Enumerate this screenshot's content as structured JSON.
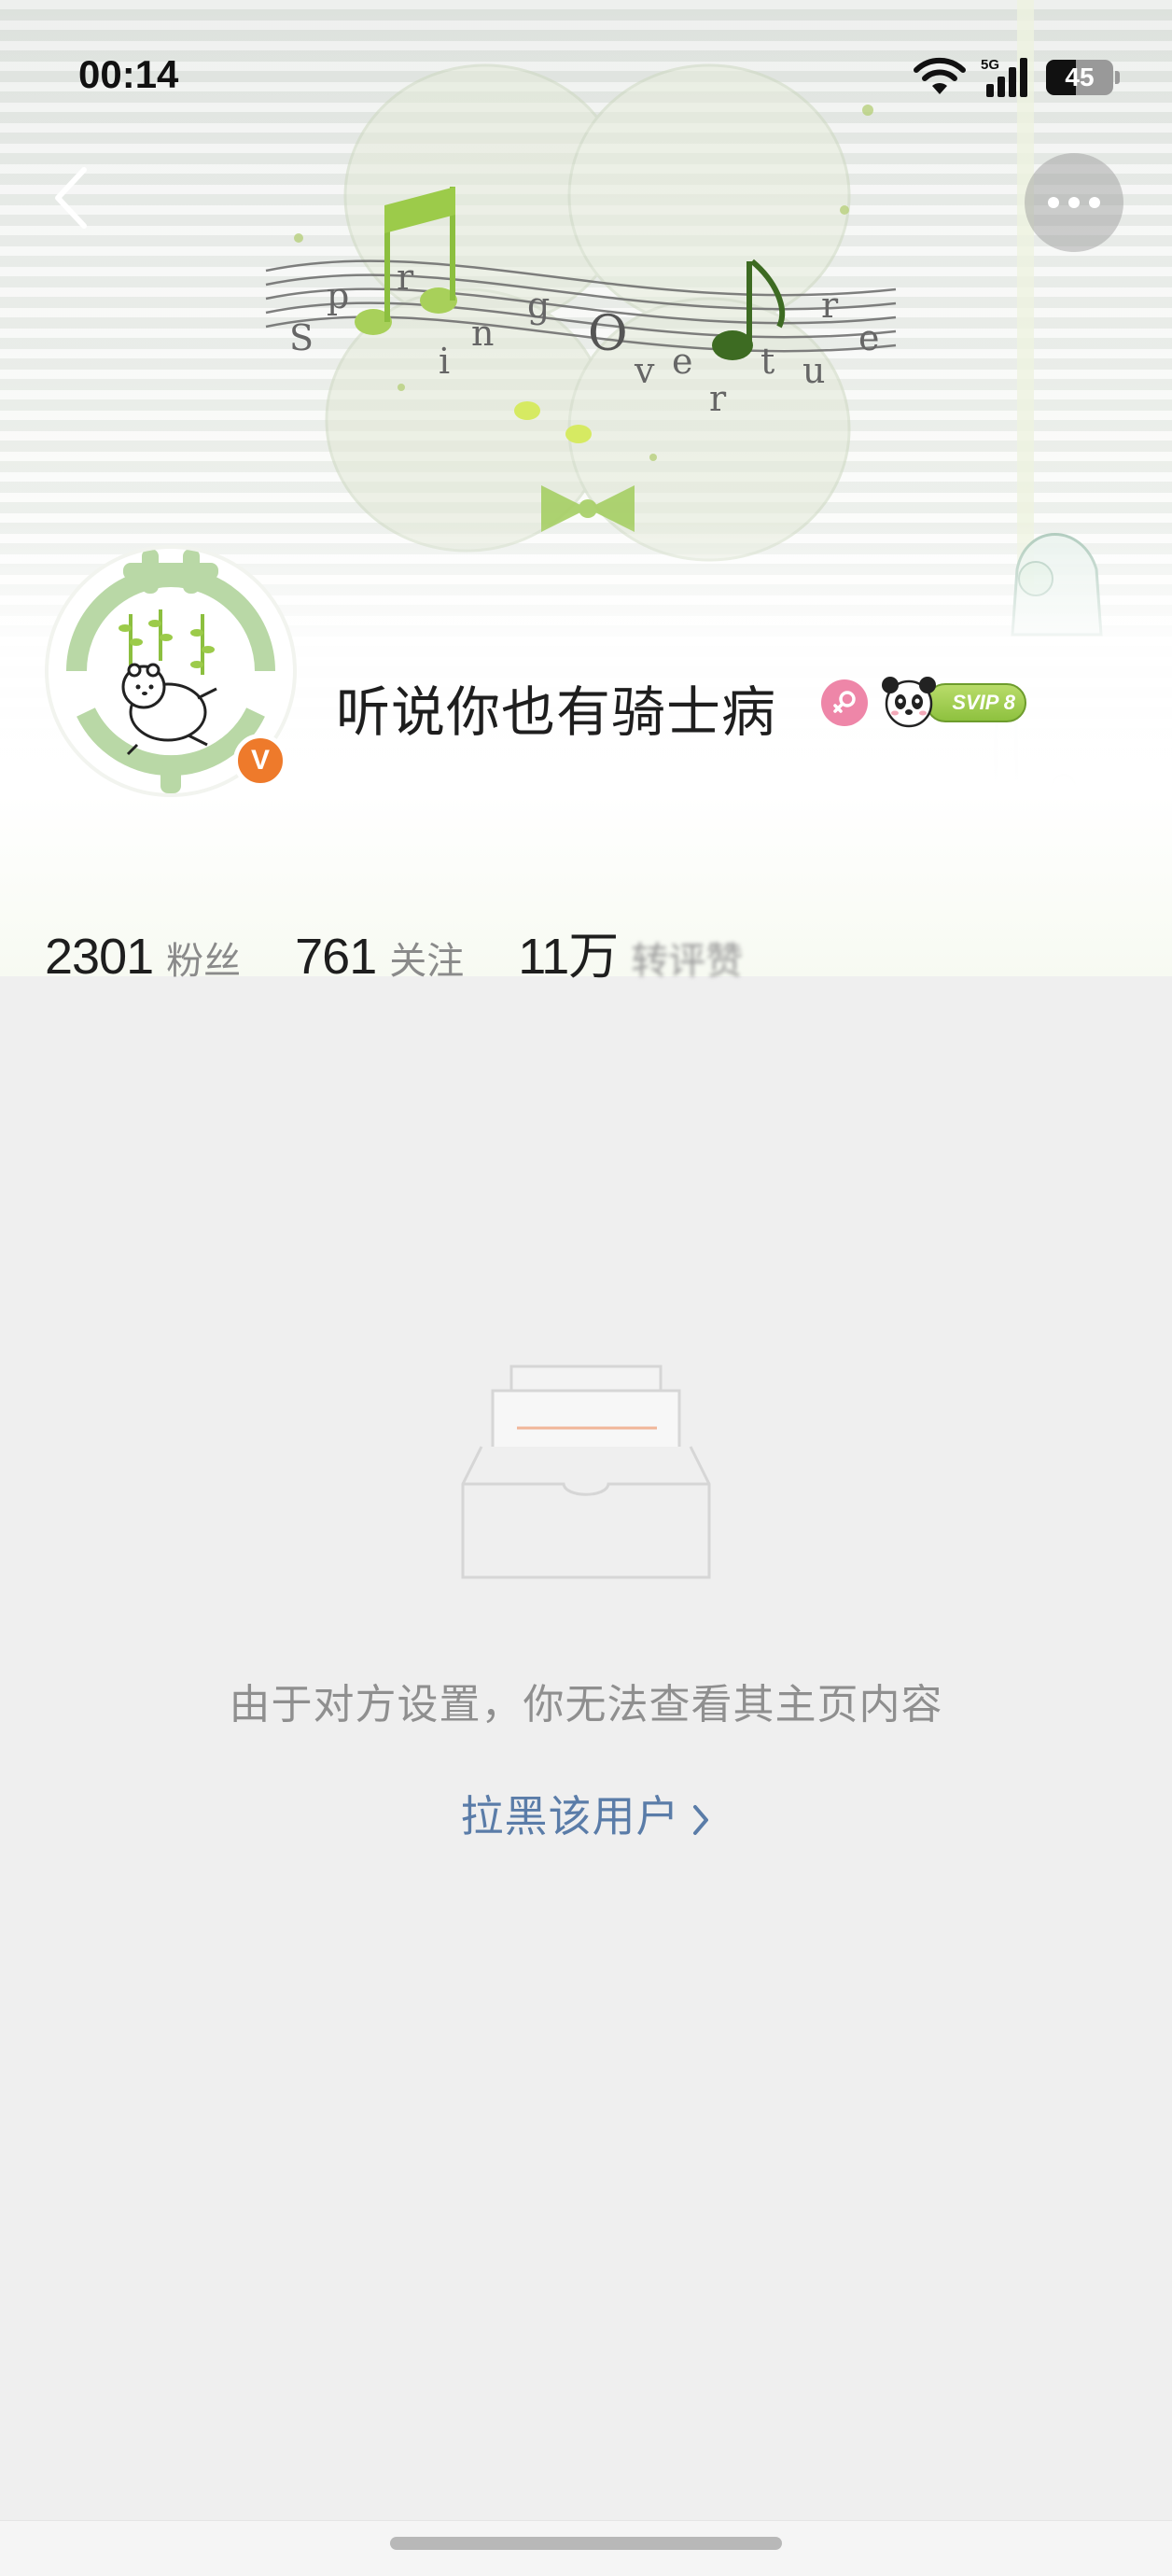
{
  "status_bar": {
    "time": "00:14",
    "network": "5G",
    "battery_level": "45",
    "battery_fraction": 0.45
  },
  "nav": {
    "back_icon": "chevron-left-icon",
    "more_icon": "more-horizontal-icon"
  },
  "banner": {
    "art_text": "Spring Overture"
  },
  "profile": {
    "username": "听说你也有骑士病",
    "gender": "female",
    "vip_badge": "SVIP 8",
    "verified_icon": "V",
    "colors": {
      "verified": "#ee7a2b",
      "gender": "#ee86a8",
      "vip": "#8ec13f"
    }
  },
  "stats": [
    {
      "value": "2301",
      "label": "粉丝"
    },
    {
      "value": "761",
      "label": "关注"
    },
    {
      "value": "11万",
      "label": "转评赞"
    }
  ],
  "empty_state": {
    "icon": "empty-inbox-icon",
    "message": "由于对方设置，你无法查看其主页内容",
    "action_label": "拉黑该用户",
    "action_color": "#5a7ca8"
  }
}
